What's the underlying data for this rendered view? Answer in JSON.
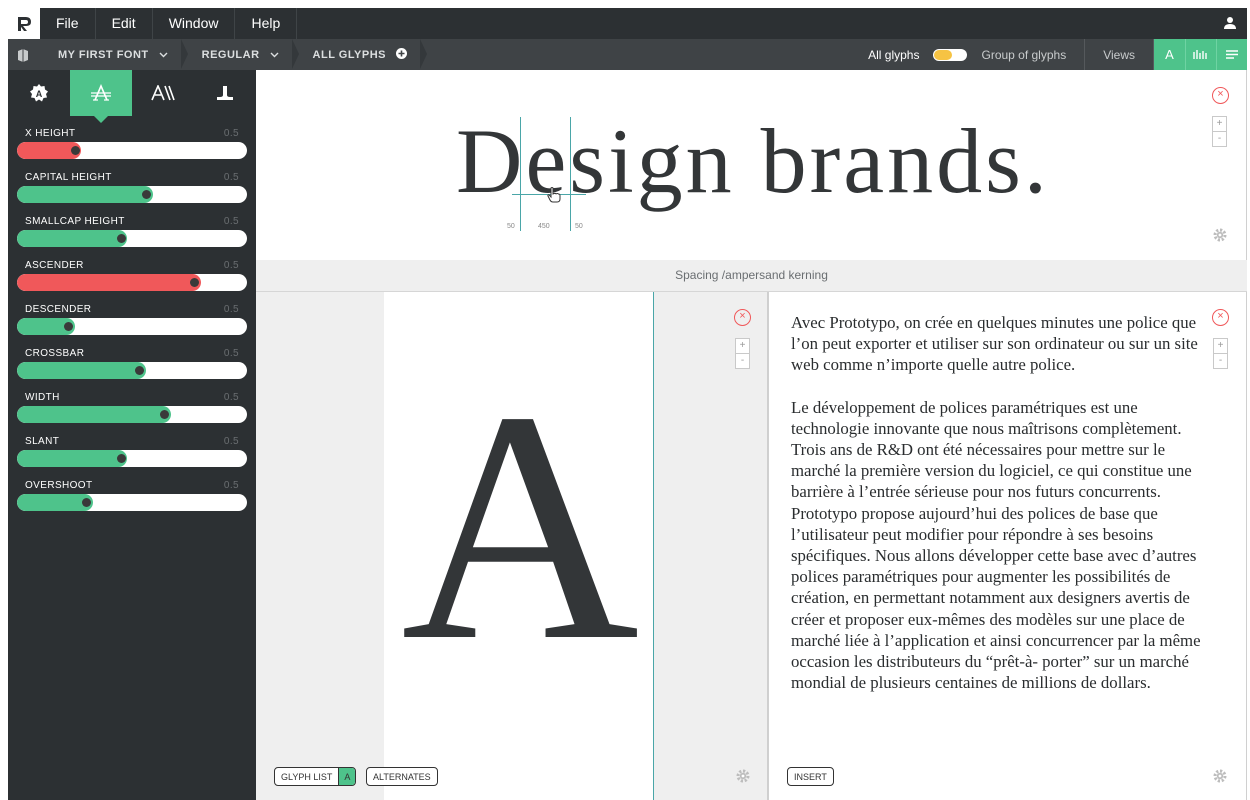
{
  "menu": {
    "items": [
      {
        "label": "File"
      },
      {
        "label": "Edit"
      },
      {
        "label": "Window"
      },
      {
        "label": "Help"
      }
    ]
  },
  "toolbar": {
    "crumbs": [
      {
        "label": "MY FIRST FONT"
      },
      {
        "label": "REGULAR"
      },
      {
        "label": "ALL GLYPHS"
      }
    ],
    "all_glyphs_label": "All glyphs",
    "group_label": "Group of glyphs",
    "views_label": "Views",
    "view_a_label": "A"
  },
  "sidebar": {
    "sliders": [
      {
        "label": "X HEIGHT",
        "value": "0.5",
        "level": 0.25,
        "state": "error"
      },
      {
        "label": "CAPITAL HEIGHT",
        "value": "0.5",
        "level": 0.56,
        "state": "ok"
      },
      {
        "label": "SMALLCAP HEIGHT",
        "value": "0.5",
        "level": 0.45,
        "state": "ok"
      },
      {
        "label": "ASCENDER",
        "value": "0.5",
        "level": 0.77,
        "state": "error"
      },
      {
        "label": "DESCENDER",
        "value": "0.5",
        "level": 0.22,
        "state": "ok"
      },
      {
        "label": "CROSSBAR",
        "value": "0.5",
        "level": 0.53,
        "state": "ok"
      },
      {
        "label": "WIDTH",
        "value": "0.5",
        "level": 0.64,
        "state": "ok"
      },
      {
        "label": "SLANT",
        "value": "0.5",
        "level": 0.45,
        "state": "ok"
      },
      {
        "label": "OVERSHOOT",
        "value": "0.5",
        "level": 0.3,
        "state": "ok"
      }
    ]
  },
  "preview": {
    "text": "Design brands.",
    "metrics": {
      "left": "50",
      "center": "450",
      "right": "50"
    },
    "zoom_in": "+",
    "zoom_out": "-"
  },
  "spacing_bar": {
    "label": "Spacing /ampersand kerning"
  },
  "glyph_panel": {
    "glyph": "A",
    "glyph_list_label": "GLYPH LIST",
    "glyph_list_badge": "A",
    "alternates_label": "ALTERNATES"
  },
  "text_panel": {
    "paragraphs": [
      "Avec Prototypo, on crée en quelques minutes une police que l’on peut exporter et utiliser sur son ordinateur ou sur un site web comme n’importe quelle autre police.",
      "Le développement de polices paramétriques est une technologie innovante que nous maîtrisons complètement. Trois ans de R&D ont été nécessaires pour mettre sur le marché la première version du logiciel, ce qui constitue une barrière à l’entrée sérieuse pour nos futurs concurrents. Prototypo propose aujourd’hui des polices de base que l’utilisateur peut modifier pour répondre à ses besoins spécifiques. Nous allons développer cette base avec d’autres polices paramétriques pour augmenter les possibilités de création, en permettant notamment aux designers avertis de créer et proposer eux-mêmes des modèles sur une place de marché liée à l’application et ainsi concurrencer par la même occasion les distributeurs du “prêt-à- porter” sur un marché mondial de plusieurs centaines de millions de dollars."
    ],
    "insert_label": "INSERT"
  },
  "colors": {
    "accent": "#4ec38b",
    "error": "#f0585a",
    "dark": "#2c3033",
    "toggle_knob": "#f6c343"
  }
}
